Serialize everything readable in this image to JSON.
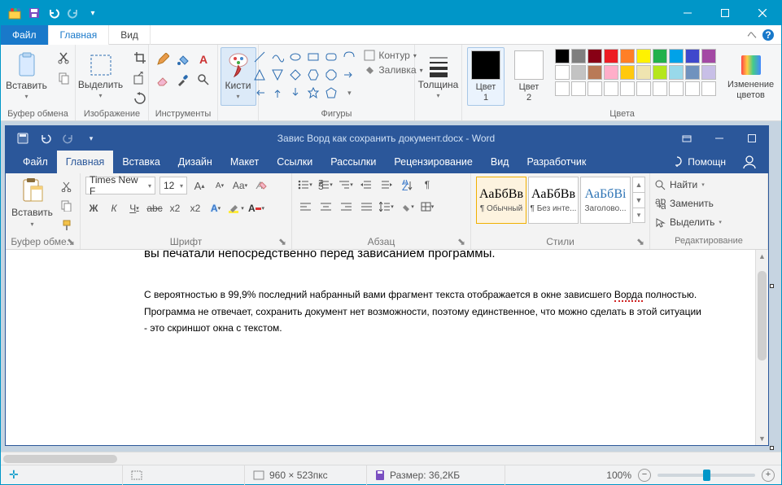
{
  "paint": {
    "tabs": {
      "file": "Файл",
      "main": "Главная",
      "view": "Вид"
    },
    "clipboard": {
      "paste": "Вставить",
      "group": "Буфер обмена"
    },
    "image": {
      "select": "Выделить",
      "group": "Изображение"
    },
    "tools": {
      "group": "Инструменты"
    },
    "brushes": {
      "label": "Кисти"
    },
    "shapes": {
      "outline": "Контур",
      "fill": "Заливка",
      "group": "Фигуры"
    },
    "size": {
      "label": "Толщина"
    },
    "color1": {
      "label": "Цвет\n1"
    },
    "color2": {
      "label": "Цвет\n2"
    },
    "colors_group": "Цвета",
    "editcolors": "Изменение\nцветов",
    "palette": [
      "#000000",
      "#7f7f7f",
      "#880015",
      "#ed1c24",
      "#ff7f27",
      "#fff200",
      "#22b14c",
      "#00a2e8",
      "#3f48cc",
      "#a349a4",
      "#ffffff",
      "#c3c3c3",
      "#b97a57",
      "#ffaec9",
      "#ffc90e",
      "#efe4b0",
      "#b5e61d",
      "#99d9ea",
      "#7092be",
      "#c8bfe7",
      "#ffffff",
      "#ffffff",
      "#ffffff",
      "#ffffff",
      "#ffffff",
      "#ffffff",
      "#ffffff",
      "#ffffff",
      "#ffffff",
      "#ffffff"
    ],
    "current_color1": "#000000",
    "current_color2": "#ffffff"
  },
  "status": {
    "pos_icon": "✛",
    "dims_label": "960 × 523пкс",
    "size_label": "Размер: 36,2КБ",
    "zoom": "100%"
  },
  "word": {
    "title": "Завис Ворд как сохранить документ.docx - Word",
    "tabs": [
      "Файл",
      "Главная",
      "Вставка",
      "Дизайн",
      "Макет",
      "Ссылки",
      "Рассылки",
      "Рецензирование",
      "Вид",
      "Разработчик"
    ],
    "help": "Помощн",
    "clipboard": {
      "paste": "Вставить",
      "group": "Буфер обме..."
    },
    "font": {
      "name": "Times New F",
      "size": "12",
      "group": "Шрифт"
    },
    "para": {
      "group": "Абзац"
    },
    "styles": {
      "group": "Стили",
      "items": [
        {
          "sample": "АаБбВв",
          "cap": "¶ Обычный",
          "sel": true,
          "color": "#000"
        },
        {
          "sample": "АаБбВв",
          "cap": "¶ Без инте...",
          "sel": false,
          "color": "#000"
        },
        {
          "sample": "АаБбВі",
          "cap": "Заголово...",
          "sel": false,
          "color": "#2e74b5"
        }
      ]
    },
    "editing": {
      "find": "Найти",
      "replace": "Заменить",
      "select": "Выделить",
      "group": "Редактирование"
    },
    "doc": {
      "p0": "вы печатали непосредственно перед зависанием программы.",
      "p1a": "С вероятностью в 99,9% последний набранный вами фрагмент текста отображается в окне зависшего ",
      "p1u": "Ворда",
      "p1b": " полностью. Программа не отвечает, сохранить документ нет возможности, поэтому единственное, что можно сделать в этой ситуации - это скриншот окна с текстом."
    }
  }
}
